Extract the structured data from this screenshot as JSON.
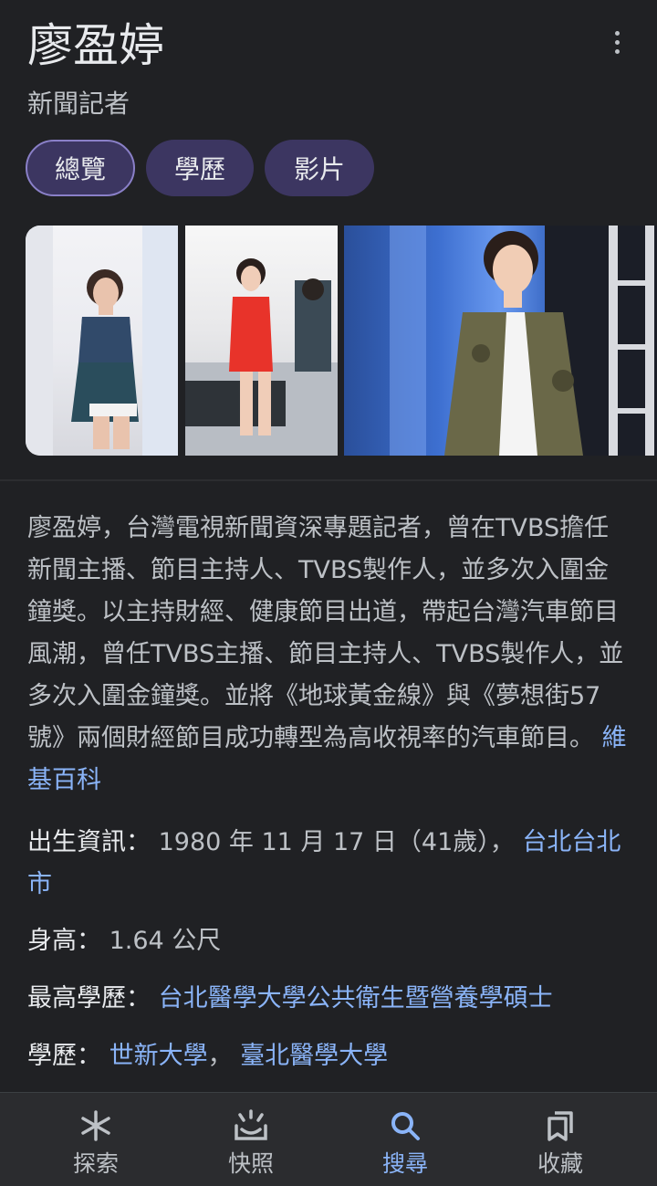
{
  "header": {
    "title": "廖盈婷",
    "subtitle": "新聞記者"
  },
  "chips": [
    {
      "label": "總覽",
      "active": true
    },
    {
      "label": "學歷",
      "active": false
    },
    {
      "label": "影片",
      "active": false
    }
  ],
  "description": {
    "text": "廖盈婷，台灣電視新聞資深專題記者，曾在TVBS擔任新聞主播、節目主持人、TVBS製作人，並多次入圍金鐘獎。以主持財經、健康節目出道，帶起台灣汽車節目風潮，曾任TVBS主播、節目主持人、TVBS製作人，並多次入圍金鐘獎。並將《地球黃金線》與《夢想街57號》兩個財經節目成功轉型為高收視率的汽車節目。",
    "source_link": "維基百科"
  },
  "facts": {
    "birth_label": "出生資訊：",
    "birth_value": "1980 年 11 月 17 日（41歲），",
    "birth_place": "台北台北市",
    "height_label": "身高：",
    "height_value": "1.64 公尺",
    "top_edu_label": "最高學歷：",
    "top_edu_value": "台北醫學大學公共衛生暨營養學碩士",
    "edu_label": "學歷：",
    "edu_value_1": "世新大學",
    "edu_sep": "，",
    "edu_value_2": "臺北醫學大學"
  },
  "bottom_nav": [
    {
      "label": "探索",
      "icon": "asterisk-icon",
      "active": false
    },
    {
      "label": "快照",
      "icon": "snapshot-icon",
      "active": false
    },
    {
      "label": "搜尋",
      "icon": "search-icon",
      "active": true
    },
    {
      "label": "收藏",
      "icon": "collections-icon",
      "active": false
    }
  ],
  "colors": {
    "background": "#202124",
    "chip": "#3c3661",
    "link": "#8ab4f8"
  }
}
